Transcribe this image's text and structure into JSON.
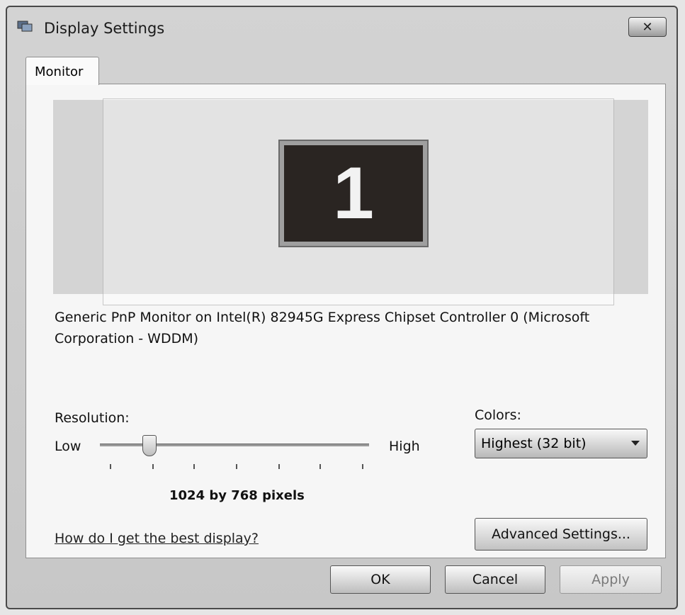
{
  "window": {
    "title": "Display Settings",
    "close_glyph": "✕"
  },
  "tabs": [
    {
      "label": "Monitor",
      "selected": true
    }
  ],
  "monitor_preview": {
    "number": "1",
    "description": "Generic PnP Monitor on Intel(R) 82945G Express Chipset Controller 0 (Microsoft Corporation - WDDM)"
  },
  "resolution": {
    "label": "Resolution:",
    "low_label": "Low",
    "high_label": "High",
    "value_text": "1024 by 768 pixels",
    "tick_count": 7,
    "selected_tick_index": 1
  },
  "colors": {
    "label": "Colors:",
    "selected": "Highest (32 bit)"
  },
  "help_link": "How do I get the best display?",
  "advanced_button": "Advanced Settings...",
  "footer": {
    "ok_label": "OK",
    "cancel_label": "Cancel",
    "apply_label": "Apply",
    "apply_enabled": false
  },
  "icons": {
    "window_icon": "display-settings-icon",
    "close_icon": "close-icon",
    "dropdown_icon": "chevron-down-icon",
    "thumb_icon": "slider-thumb"
  }
}
